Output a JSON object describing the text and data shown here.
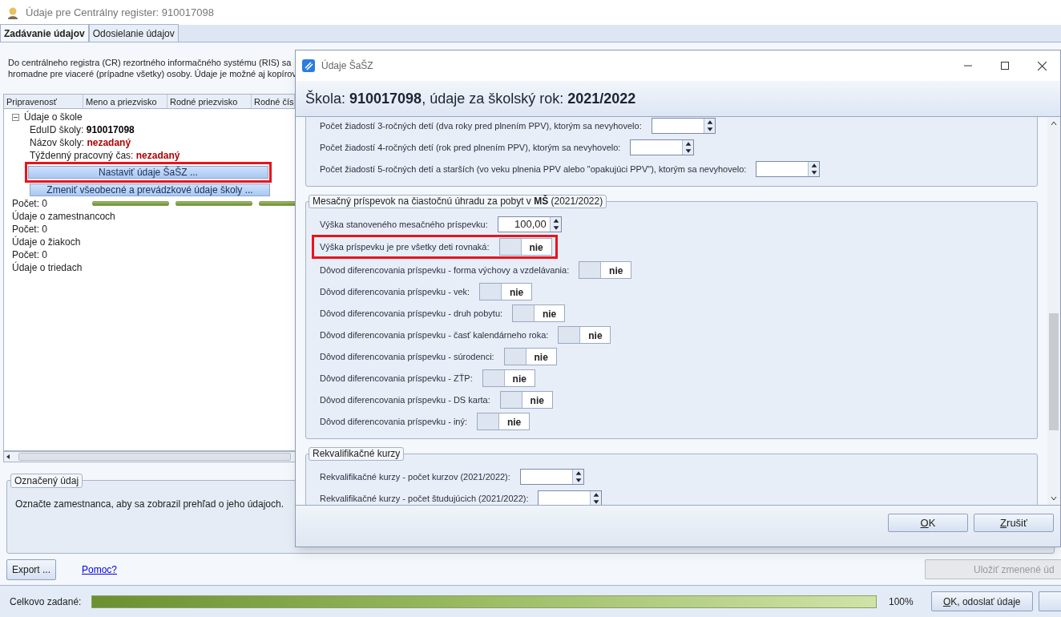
{
  "window": {
    "title": "Údaje pre Centrálny register: 910017098"
  },
  "tabs": [
    {
      "label": "Zadávanie údajov",
      "selected": true
    },
    {
      "label": "Odosielanie údajov",
      "selected": false
    }
  ],
  "intro": [
    "Do centrálneho registra (CR) rezortného informačného systému (RIS) sa",
    "hromadne pre viaceré (prípadne všetky) osoby. Údaje je možné aj kopírov"
  ],
  "grid": {
    "columns": [
      "Pripravenosť",
      "Meno a priezvisko",
      "Rodné priezvisko",
      "Rodné čís"
    ],
    "tree": {
      "label": "Údaje o škole",
      "expanded": true,
      "children": [
        {
          "kind": "field",
          "label": "EduID školy:",
          "value": "910017098",
          "missing": false
        },
        {
          "kind": "field",
          "label": "Názov školy:",
          "value": "nezadaný",
          "missing": true
        },
        {
          "kind": "field",
          "label": "Týždenný pracovný čas:",
          "value": "nezadaný",
          "missing": true
        },
        {
          "kind": "button",
          "label": "Nastaviť údaje ŠaŠZ ...",
          "highlighted": true
        },
        {
          "kind": "button",
          "label": "Zmeniť všeobecné a prevádzkové údaje školy ...",
          "highlighted": false
        }
      ]
    },
    "rows": [
      {
        "label": "Počet: 0",
        "bars": [
          {
            "level": 1
          },
          {
            "level": 1
          },
          {
            "level": 1
          }
        ]
      },
      {
        "label": "Údaje o zamestnancoch"
      },
      {
        "label": "Počet: 0"
      },
      {
        "label": "Údaje o žiakoch"
      },
      {
        "label": "Počet: 0"
      },
      {
        "label": "Údaje o triedach"
      }
    ]
  },
  "selected_item": {
    "title": "Označený údaj",
    "text": "Označte zamestnanca, aby sa zobrazil prehľad o jeho údajoch."
  },
  "export_button": "Export ...",
  "help_link": "Pomoc?",
  "save_button": {
    "label": "Uložiť zmenené úd",
    "disabled": true
  },
  "status_bar": {
    "label": "Celkovo zadané:",
    "level": 1,
    "percent": "100%",
    "send_button": "OK, odoslať údaje"
  },
  "dialog": {
    "title": "Údaje ŠaŠZ",
    "header": "Škola: **910017098**, údaje za školský rok: **2021/2022**",
    "groups": [
      {
        "rows": [
          {
            "kind": "number",
            "label": "Počet žiadostí 3-ročných detí (dva roky pred plnením PPV), ktorým sa nevyhovelo:"
          },
          {
            "kind": "number",
            "label": "Počet žiadostí 4-ročných detí (rok pred plnením PPV), ktorým sa nevyhovelo:"
          },
          {
            "kind": "number",
            "label": "Počet žiadostí 5-ročných detí a starších (vo veku plnenia PPV alebo \"opakujúci PPV\"), ktorým sa nevyhovelo:"
          }
        ]
      },
      {
        "title": "Mesačný príspevok na čiastočnú úhradu za pobyt v **MŠ** (2021/2022)",
        "rows": [
          {
            "kind": "number",
            "label": "Výška stanoveného mesačného príspevku:",
            "value": "100,00"
          },
          {
            "kind": "toggle",
            "label": "Výška príspevku je pre všetky deti rovnaká:",
            "value": "nie",
            "on": false,
            "highlighted": true
          },
          {
            "kind": "toggle",
            "label": "Dôvod diferencovania príspevku - forma výchovy a vzdelávania:",
            "value": "nie",
            "on": false,
            "highlighted": false
          },
          {
            "kind": "toggle",
            "label": "Dôvod diferencovania príspevku - vek:",
            "value": "nie",
            "on": false,
            "highlighted": false
          },
          {
            "kind": "toggle",
            "label": "Dôvod diferencovania príspevku - druh pobytu:",
            "value": "nie",
            "on": false,
            "highlighted": false
          },
          {
            "kind": "toggle",
            "label": "Dôvod diferencovania príspevku - časť kalendárneho roka:",
            "value": "nie",
            "on": false,
            "highlighted": false
          },
          {
            "kind": "toggle",
            "label": "Dôvod diferencovania príspevku - súrodenci:",
            "value": "nie",
            "on": false,
            "highlighted": false
          },
          {
            "kind": "toggle",
            "label": "Dôvod diferencovania príspevku - ZŤP:",
            "value": "nie",
            "on": false,
            "highlighted": false
          },
          {
            "kind": "toggle",
            "label": "Dôvod diferencovania príspevku - DS karta:",
            "value": "nie",
            "on": false,
            "highlighted": false
          },
          {
            "kind": "toggle",
            "label": "Dôvod diferencovania príspevku - iný:",
            "value": "nie",
            "on": false,
            "highlighted": false
          }
        ]
      },
      {
        "title": "Rekvalifikačné kurzy",
        "rows": [
          {
            "kind": "number",
            "label": "Rekvalifikačné kurzy - počet kurzov (2021/2022):"
          },
          {
            "kind": "number",
            "label": "Rekvalifikačné kurzy - počet študujúcich (2021/2022):"
          }
        ]
      }
    ],
    "buttons": [
      "OK",
      "Zrušiť"
    ]
  }
}
